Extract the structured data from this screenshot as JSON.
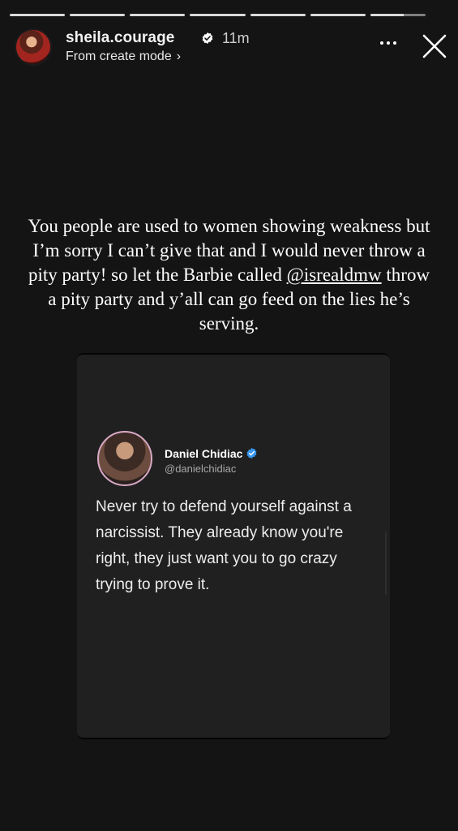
{
  "progress": {
    "segments": [
      1,
      1,
      1,
      1,
      1,
      1,
      0.6
    ]
  },
  "header": {
    "username": "sheila.courage",
    "time": "11m",
    "subtitle": "From create mode",
    "subtitle_chevron": "›"
  },
  "caption": {
    "before_mention": "You people are used to women showing weakness but I’m sorry I can’t give that and I would never throw a pity party! so let the Barbie called ",
    "mention": "@isrealdmw",
    "after_mention": " throw a pity party and y’all can go feed on the lies he’s serving."
  },
  "tweet": {
    "name": "Daniel Chidiac",
    "handle": "@danielchidiac",
    "text": "Never try to defend yourself against a narcissist. They already know you're right, they just want you to go crazy trying to prove it."
  },
  "colors": {
    "background": "#141414",
    "card": "#202020",
    "verified_blue": "#3897f0"
  },
  "icons": {
    "verified": "verified-badge-icon",
    "more": "more-options-icon",
    "close": "close-icon"
  }
}
